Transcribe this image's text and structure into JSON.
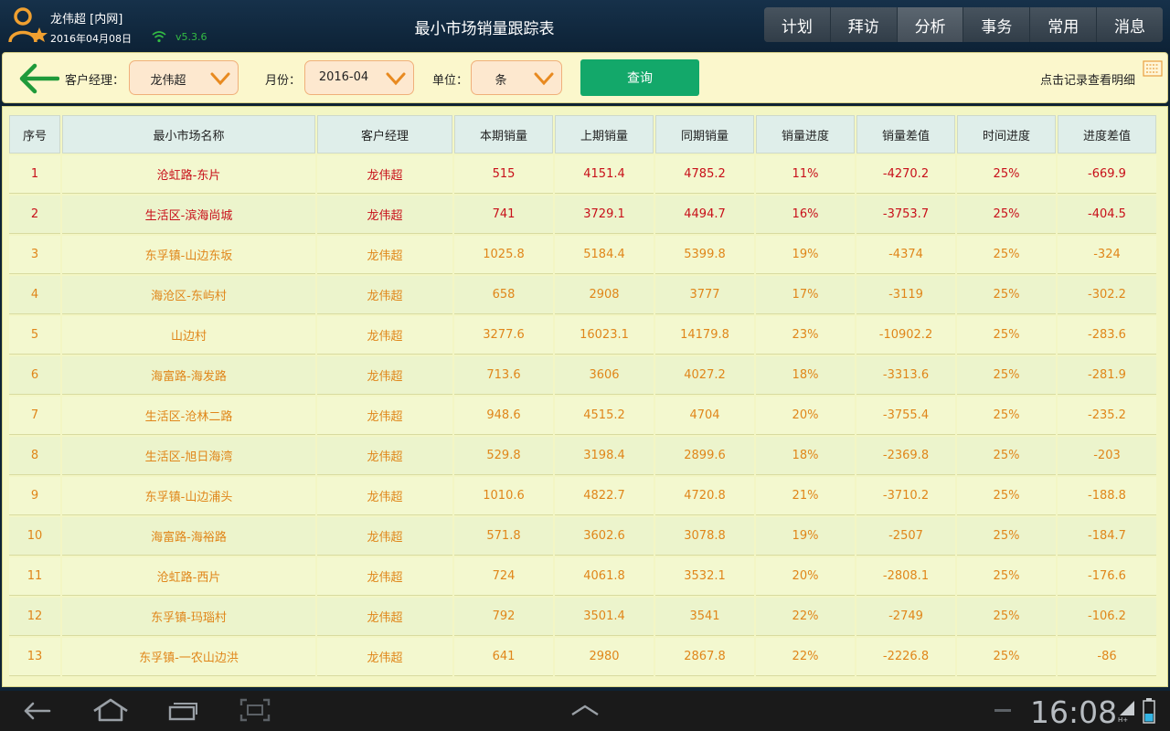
{
  "header": {
    "user_name": "龙伟超 [内网]",
    "date": "2016年04月08日",
    "version": "v5.3.6",
    "title": "最小市场销量跟踪表",
    "nav": [
      "计划",
      "拜访",
      "分析",
      "事务",
      "常用",
      "消息"
    ],
    "active_nav": "分析"
  },
  "filter": {
    "manager_label": "客户经理：",
    "manager_value": "龙伟超",
    "month_label": "月份：",
    "month_value": "2016-04",
    "unit_label": "单位：",
    "unit_value": "条",
    "query_label": "查询",
    "hint": "点击记录查看明细"
  },
  "table": {
    "headers": [
      "序号",
      "最小市场名称",
      "客户经理",
      "本期销量",
      "上期销量",
      "同期销量",
      "销量进度",
      "销量差值",
      "时间进度",
      "进度差值"
    ],
    "rows": [
      [
        "1",
        "沧虹路-东片",
        "龙伟超",
        "515",
        "4151.4",
        "4785.2",
        "11%",
        "-4270.2",
        "25%",
        "-669.9"
      ],
      [
        "2",
        "生活区-滨海尚城",
        "龙伟超",
        "741",
        "3729.1",
        "4494.7",
        "16%",
        "-3753.7",
        "25%",
        "-404.5"
      ],
      [
        "3",
        "东孚镇-山边东坂",
        "龙伟超",
        "1025.8",
        "5184.4",
        "5399.8",
        "19%",
        "-4374",
        "25%",
        "-324"
      ],
      [
        "4",
        "海沧区-东屿村",
        "龙伟超",
        "658",
        "2908",
        "3777",
        "17%",
        "-3119",
        "25%",
        "-302.2"
      ],
      [
        "5",
        "山边村",
        "龙伟超",
        "3277.6",
        "16023.1",
        "14179.8",
        "23%",
        "-10902.2",
        "25%",
        "-283.6"
      ],
      [
        "6",
        "海富路-海发路",
        "龙伟超",
        "713.6",
        "3606",
        "4027.2",
        "18%",
        "-3313.6",
        "25%",
        "-281.9"
      ],
      [
        "7",
        "生活区-沧林二路",
        "龙伟超",
        "948.6",
        "4515.2",
        "4704",
        "20%",
        "-3755.4",
        "25%",
        "-235.2"
      ],
      [
        "8",
        "生活区-旭日海湾",
        "龙伟超",
        "529.8",
        "3198.4",
        "2899.6",
        "18%",
        "-2369.8",
        "25%",
        "-203"
      ],
      [
        "9",
        "东孚镇-山边浦头",
        "龙伟超",
        "1010.6",
        "4822.7",
        "4720.8",
        "21%",
        "-3710.2",
        "25%",
        "-188.8"
      ],
      [
        "10",
        "海富路-海裕路",
        "龙伟超",
        "571.8",
        "3602.6",
        "3078.8",
        "19%",
        "-2507",
        "25%",
        "-184.7"
      ],
      [
        "11",
        "沧虹路-西片",
        "龙伟超",
        "724",
        "4061.8",
        "3532.1",
        "20%",
        "-2808.1",
        "25%",
        "-176.6"
      ],
      [
        "12",
        "东孚镇-玛瑙村",
        "龙伟超",
        "792",
        "3501.4",
        "3541",
        "22%",
        "-2749",
        "25%",
        "-106.2"
      ],
      [
        "13",
        "东孚镇-一农山边洪",
        "龙伟超",
        "641",
        "2980",
        "2867.8",
        "22%",
        "-2226.8",
        "25%",
        "-86"
      ]
    ],
    "row_status": [
      "critical",
      "critical",
      "warning",
      "warning",
      "warning",
      "warning",
      "warning",
      "warning",
      "warning",
      "warning",
      "warning",
      "warning",
      "warning"
    ]
  },
  "colors": {
    "critical": "#c8101a",
    "warning": "#e0861a",
    "accent_green": "#13a86a",
    "avatar_orange": "#f0a030"
  },
  "system": {
    "clock": "16:08",
    "icons": [
      "back-icon",
      "home-icon",
      "recent-apps-icon",
      "screenshot-icon",
      "up-arrow-icon",
      "signal-icon",
      "battery-icon"
    ]
  }
}
